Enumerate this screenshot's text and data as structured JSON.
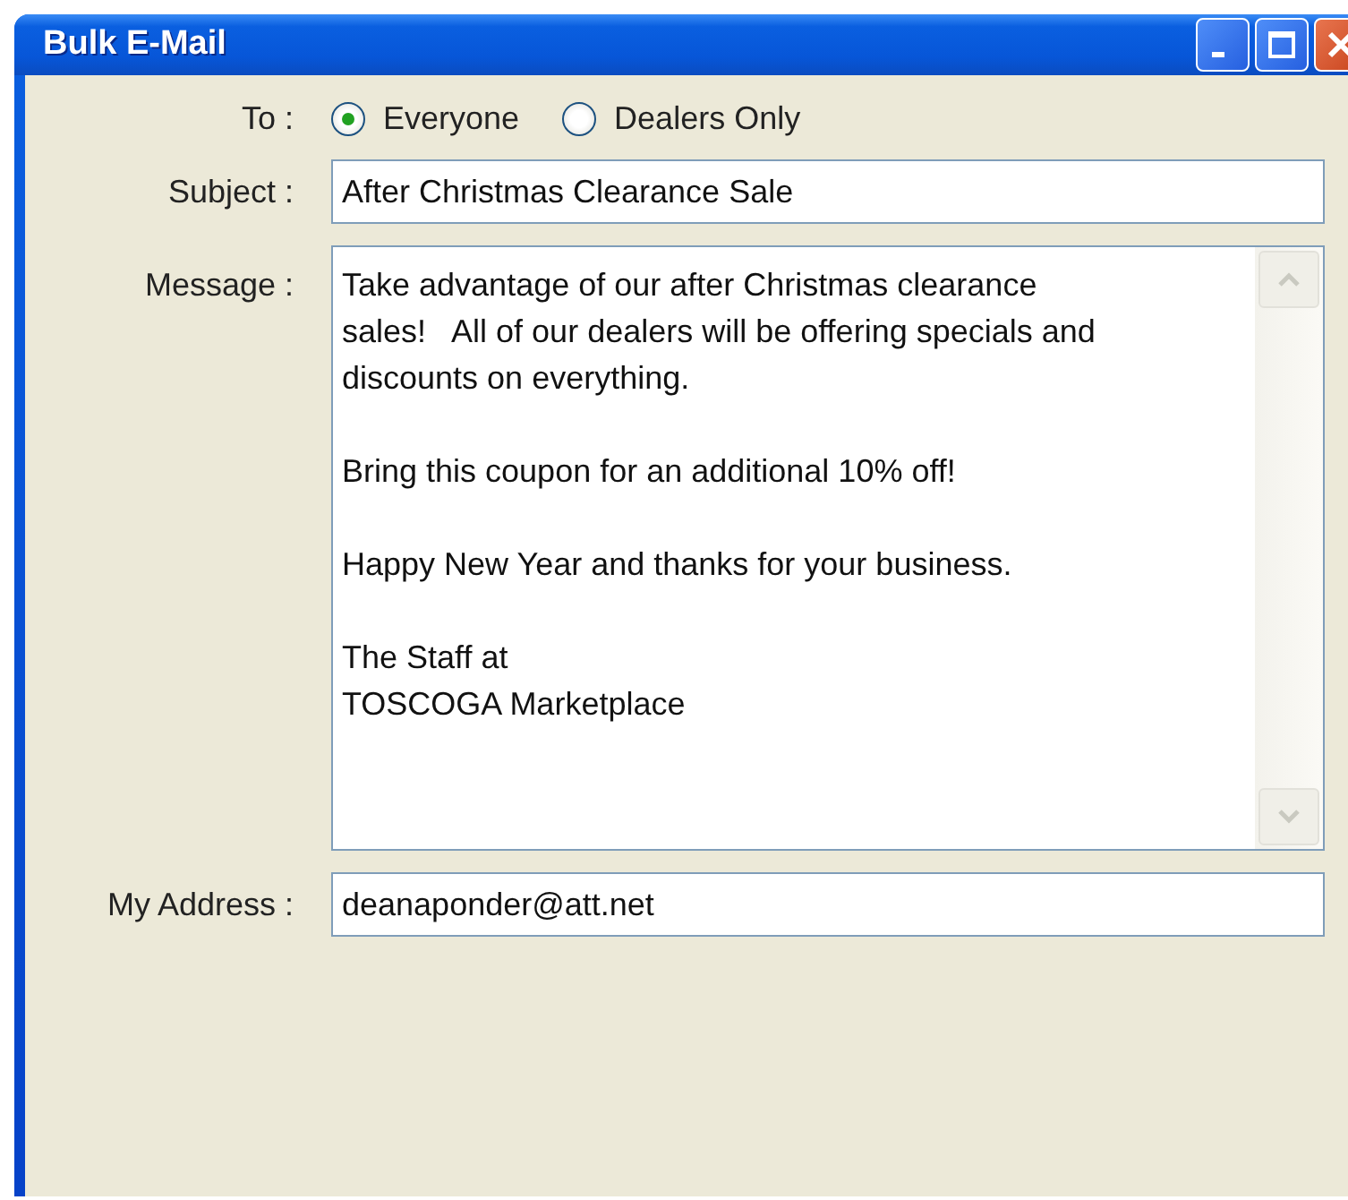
{
  "window": {
    "title": "Bulk E-Mail"
  },
  "to": {
    "label": "To :",
    "options": [
      {
        "label": "Everyone",
        "selected": true
      },
      {
        "label": "Dealers Only",
        "selected": false
      }
    ]
  },
  "subject": {
    "label": "Subject :",
    "value": "After Christmas Clearance Sale"
  },
  "message": {
    "label": "Message :",
    "value": "Take advantage of our after Christmas clearance\nsales!   All of our dealers will be offering specials and\ndiscounts on everything.\n\nBring this coupon for an additional 10% off!\n\nHappy New Year and thanks for your business.\n\nThe Staff at\nTOSCOGA Marketplace"
  },
  "my_address": {
    "label": "My Address :",
    "value": "deanaponder@att.net"
  }
}
